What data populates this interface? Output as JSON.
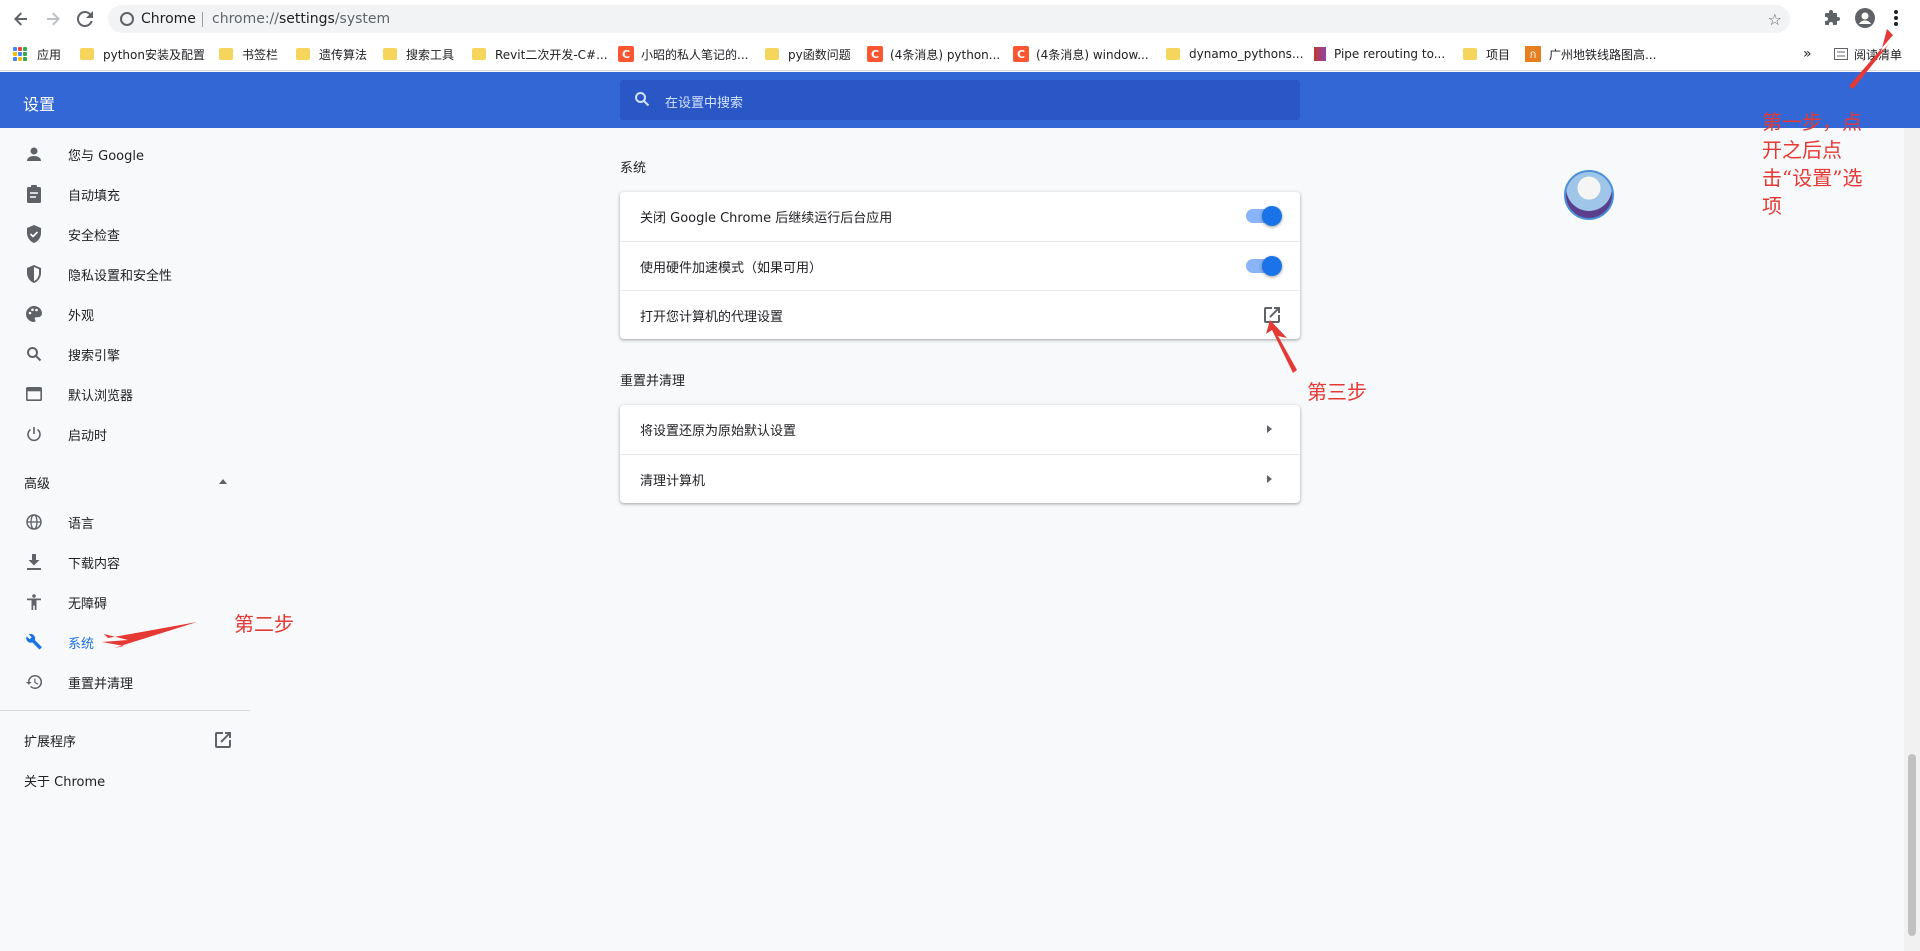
{
  "browser": {
    "site_label": "Chrome",
    "url_prefix": "chrome://",
    "url_host": "settings",
    "url_path": "/system"
  },
  "bookmarks": [
    {
      "label": "应用",
      "type": "apps"
    },
    {
      "label": "python安装及配置",
      "type": "folder"
    },
    {
      "label": "书签栏",
      "type": "folder"
    },
    {
      "label": "遗传算法",
      "type": "folder"
    },
    {
      "label": "搜索工具",
      "type": "folder"
    },
    {
      "label": "Revit二次开发-C#...",
      "type": "folder"
    },
    {
      "label": "小昭的私人笔记的...",
      "type": "csdn"
    },
    {
      "label": "py函数问题",
      "type": "folder"
    },
    {
      "label": "(4条消息) python...",
      "type": "csdn"
    },
    {
      "label": "(4条消息) window...",
      "type": "csdn"
    },
    {
      "label": "dynamo_pythons...",
      "type": "folder"
    },
    {
      "label": "Pipe rerouting to...",
      "type": "pipe"
    },
    {
      "label": "项目",
      "type": "folder"
    },
    {
      "label": "广州地铁线路图高...",
      "type": "gz"
    }
  ],
  "bookmarks_overflow": "»",
  "reading_list": "阅读清单",
  "header": {
    "title": "设置",
    "search_placeholder": "在设置中搜索"
  },
  "sidebar": {
    "items": [
      {
        "label": "您与 Google",
        "icon": "person-icon"
      },
      {
        "label": "自动填充",
        "icon": "clipboard-icon"
      },
      {
        "label": "安全检查",
        "icon": "shield-check-icon"
      },
      {
        "label": "隐私设置和安全性",
        "icon": "shield-icon"
      },
      {
        "label": "外观",
        "icon": "palette-icon"
      },
      {
        "label": "搜索引擎",
        "icon": "search-icon"
      },
      {
        "label": "默认浏览器",
        "icon": "browser-icon"
      },
      {
        "label": "启动时",
        "icon": "power-icon"
      }
    ],
    "advanced_label": "高级",
    "advanced_items": [
      {
        "label": "语言",
        "icon": "globe-icon"
      },
      {
        "label": "下载内容",
        "icon": "download-icon"
      },
      {
        "label": "无障碍",
        "icon": "accessibility-icon"
      },
      {
        "label": "系统",
        "icon": "wrench-icon",
        "active": true
      },
      {
        "label": "重置并清理",
        "icon": "history-icon"
      }
    ],
    "extensions_label": "扩展程序",
    "about_label": "关于 Chrome"
  },
  "system_section": {
    "title": "系统",
    "rows": [
      {
        "label": "关闭 Google Chrome 后继续运行后台应用",
        "control": "toggle",
        "on": true
      },
      {
        "label": "使用硬件加速模式（如果可用）",
        "control": "toggle",
        "on": true
      },
      {
        "label": "打开您计算机的代理设置",
        "control": "external-link"
      }
    ]
  },
  "reset_section": {
    "title": "重置并清理",
    "rows": [
      {
        "label": "将设置还原为原始默认设置"
      },
      {
        "label": "清理计算机"
      }
    ]
  },
  "annotations": {
    "step1": "第一步，点开之后点击“设置”选项",
    "step2": "第二步",
    "step3": "第三步"
  },
  "colors": {
    "header_blue": "#3367d6",
    "accent": "#1a73e8",
    "annotation_red": "#e53935"
  }
}
